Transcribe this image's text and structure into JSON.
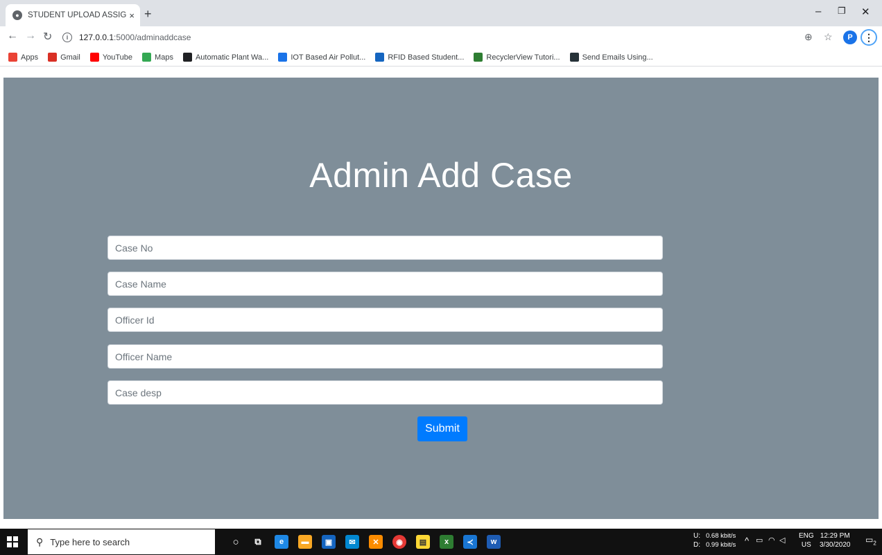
{
  "browser": {
    "tab_title": "STUDENT UPLOAD ASSIGNMENT",
    "tab_close": "×",
    "new_tab": "+",
    "url_host": "127.0.0.1",
    "url_path": ":5000/adminaddcase",
    "profile_initial": "P",
    "bookmarks": [
      {
        "label": "Apps",
        "color": "#ea4335"
      },
      {
        "label": "Gmail",
        "color": "#d93025"
      },
      {
        "label": "YouTube",
        "color": "#ff0000"
      },
      {
        "label": "Maps",
        "color": "#34a853"
      },
      {
        "label": "Automatic Plant Wa...",
        "color": "#202124"
      },
      {
        "label": "IOT Based Air Pollut...",
        "color": "#1a73e8"
      },
      {
        "label": "RFID Based Student...",
        "color": "#1565c0"
      },
      {
        "label": "RecyclerView Tutori...",
        "color": "#2e7d32"
      },
      {
        "label": "Send Emails Using...",
        "color": "#263238"
      }
    ]
  },
  "page": {
    "heading": "Admin Add Case",
    "fields": [
      {
        "name": "case-no",
        "placeholder": "Case No"
      },
      {
        "name": "case-name",
        "placeholder": "Case Name"
      },
      {
        "name": "officer-id",
        "placeholder": "Officer Id"
      },
      {
        "name": "officer-name",
        "placeholder": "Officer Name"
      },
      {
        "name": "case-desp",
        "placeholder": "Case desp"
      }
    ],
    "submit_label": "Submit",
    "background": "#7f8e99",
    "accent": "#007bff"
  },
  "taskbar": {
    "search_placeholder": "Type here to search",
    "net_u_label": "U:",
    "net_d_label": "D:",
    "net_up": "0.68 kbit/s",
    "net_down": "0.99 kbit/s",
    "lang": "ENG",
    "region": "US",
    "time": "12:29 PM",
    "date": "3/30/2020",
    "notifications": "2"
  }
}
